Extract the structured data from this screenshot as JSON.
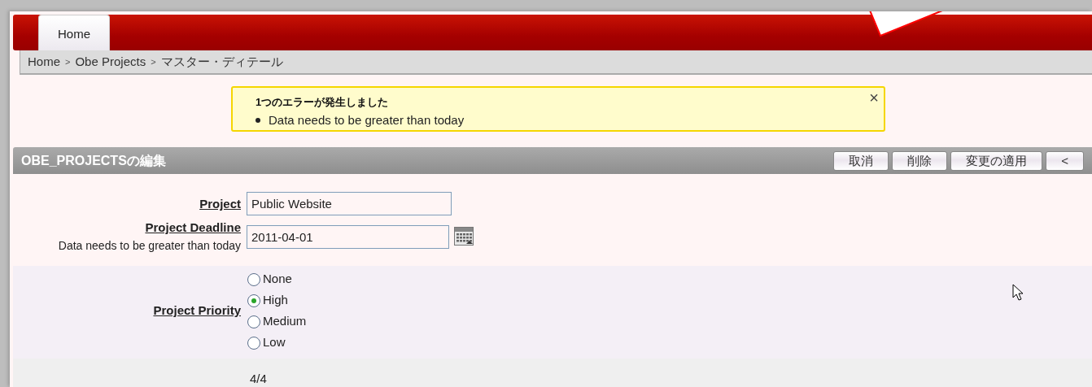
{
  "tabs": [
    {
      "label": "Home",
      "selected": true
    }
  ],
  "breadcrumb": {
    "separator": ">",
    "items": [
      "Home",
      "Obe Projects",
      "マスター・ディテール"
    ]
  },
  "error": {
    "title": "1つのエラーが発生しました",
    "messages": [
      "Data needs to be greater than today"
    ],
    "close": "×"
  },
  "region": {
    "title": "OBE_PROJECTSの編集",
    "buttons": [
      "取消",
      "削除",
      "変更の適用",
      "<"
    ]
  },
  "fields": [
    {
      "kind": "text",
      "label": "Project",
      "value": "Public Website"
    },
    {
      "kind": "date",
      "label": "Project Deadline",
      "error": "Data needs to be greater than today",
      "value": "2011-04-01"
    },
    {
      "kind": "radio",
      "label": "Project Priority",
      "options": [
        {
          "label": "None",
          "selected": false
        },
        {
          "label": "High",
          "selected": true
        },
        {
          "label": "Medium",
          "selected": false
        },
        {
          "label": "Low",
          "selected": false
        }
      ]
    }
  ],
  "pagination": "4/4"
}
